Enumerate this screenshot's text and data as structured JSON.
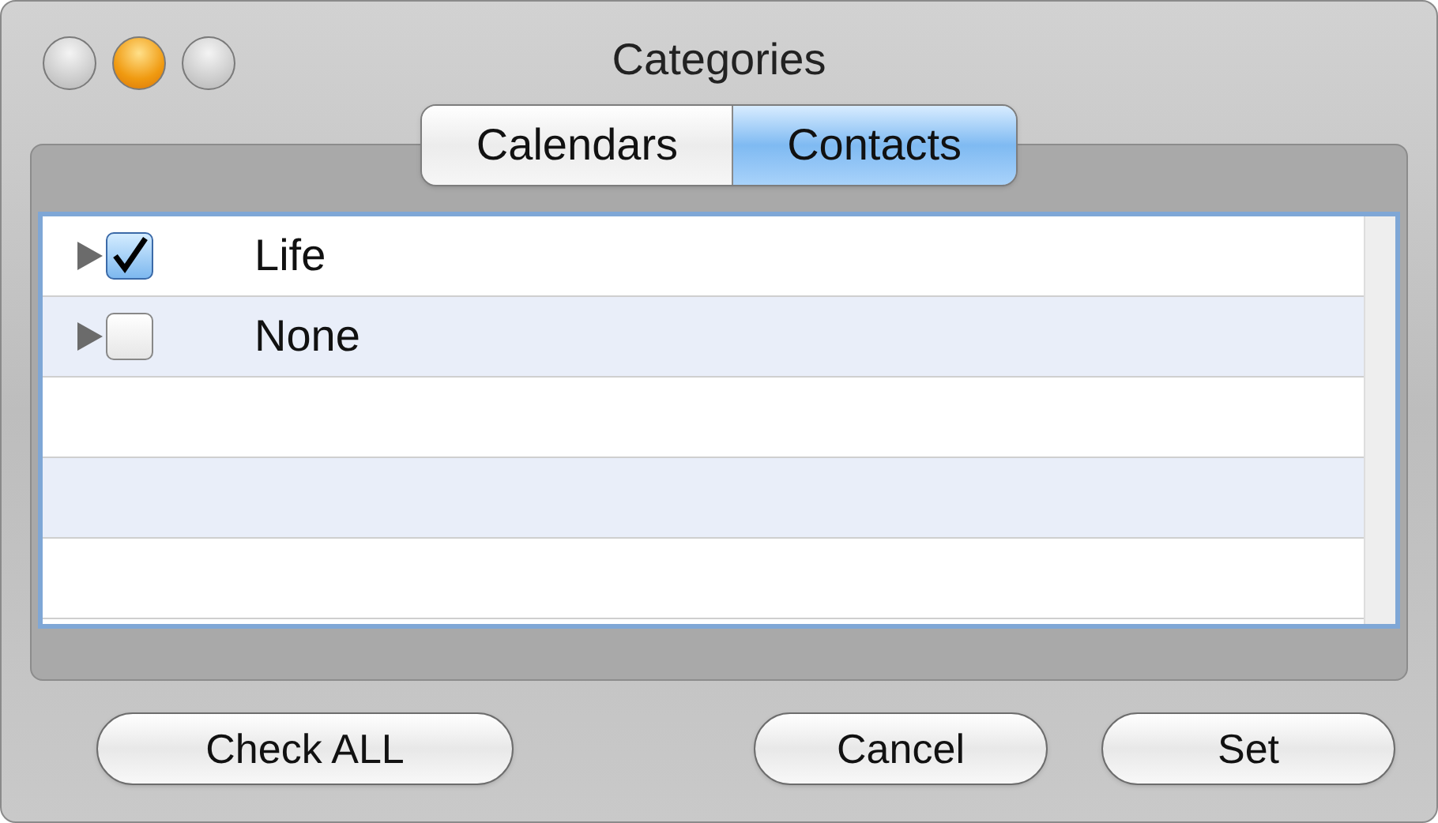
{
  "window": {
    "title": "Categories"
  },
  "tabs": [
    {
      "label": "Calendars",
      "selected": false
    },
    {
      "label": "Contacts",
      "selected": true
    }
  ],
  "list": {
    "rows": [
      {
        "label": "Life",
        "checked": true,
        "expanded": false
      },
      {
        "label": "None",
        "checked": false,
        "expanded": false
      }
    ]
  },
  "buttons": {
    "left": [
      {
        "label": "Check ALL"
      }
    ],
    "right": [
      {
        "label": "Cancel"
      },
      {
        "label": "Set"
      }
    ]
  }
}
